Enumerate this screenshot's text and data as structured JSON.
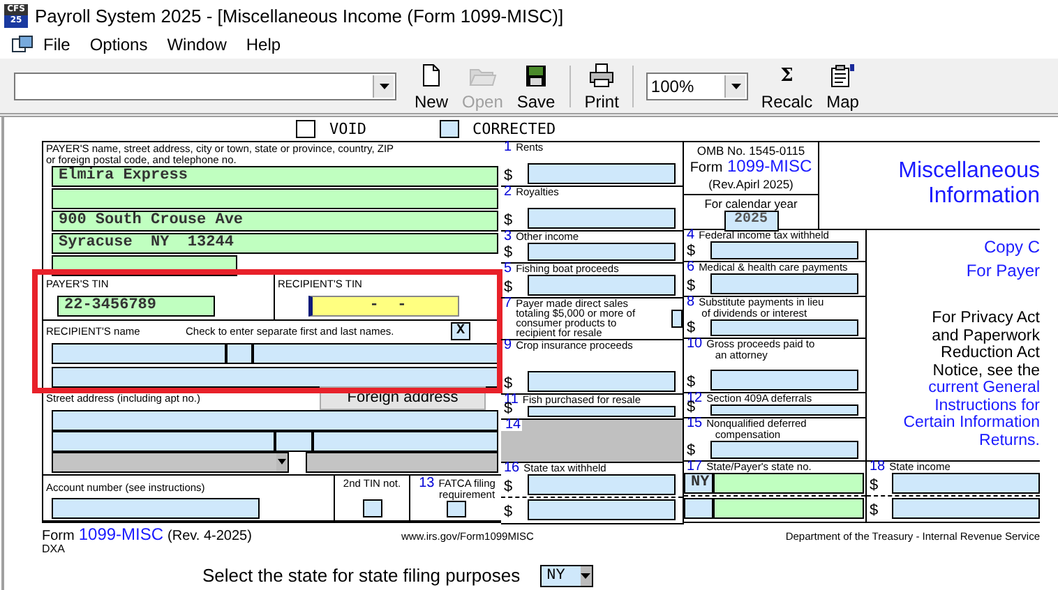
{
  "window": {
    "title": "Payroll System 2025 - [Miscellaneous Income (Form 1099-MISC)]",
    "logo": [
      "CFS",
      "25"
    ]
  },
  "menu": [
    "File",
    "Options",
    "Window",
    "Help"
  ],
  "toolbar": [
    {
      "kind": "combo"
    },
    {
      "kind": "button",
      "label": "New",
      "disabled": false
    },
    {
      "kind": "button",
      "label": "Open",
      "disabled": true
    },
    {
      "kind": "button",
      "label": "Save",
      "disabled": false
    },
    {
      "kind": "separator"
    },
    {
      "kind": "button",
      "label": "Print",
      "disabled": false
    },
    {
      "kind": "separator"
    },
    {
      "kind": "zoom",
      "value": "100%"
    },
    {
      "kind": "button",
      "label": "Recalc",
      "symbol": "Σ",
      "disabled": false
    },
    {
      "kind": "button",
      "label": "Map",
      "disabled": false
    }
  ],
  "form": {
    "marks": [
      {
        "label": "VOID",
        "checked": false,
        "kind": "plain"
      },
      {
        "label": "CORRECTED",
        "checked": false,
        "kind": "field"
      }
    ],
    "payer": {
      "label": "PAYER'S name, street address, city or town, state or province, country, ZIP\nor foreign postal code, and telephone no.",
      "lines": [
        {
          "kind": "line",
          "value": "Elmira Express"
        },
        {
          "kind": "line"
        },
        {
          "kind": "line",
          "value": "900 South Crouse Ave"
        },
        {
          "kind": "line",
          "value": "Syracuse  NY  13244"
        },
        {
          "kind": "short"
        }
      ]
    },
    "payer_tin": {
      "label": "PAYER'S TIN",
      "value": "22-3456789"
    },
    "recipient_tin": {
      "label": "RECIPIENT'S TIN",
      "value": "-  -",
      "focused": true
    },
    "recipient_name": {
      "label": "RECIPIENT'S name",
      "check_label": "Check to enter separate first and last names.",
      "checked": true,
      "mark": "X",
      "highlighted": true
    },
    "street": {
      "label": "Street address (including apt no.)",
      "button": "Foreign address"
    },
    "account": {
      "label": "Account number (see instructions)"
    },
    "second_tin": {
      "label": "2nd TIN not.",
      "checked": false
    },
    "fatca": {
      "number": "13",
      "label": "FATCA filing\nrequirement",
      "checked": false
    },
    "left_boxes": [
      {
        "number": "1",
        "label": "Rents",
        "kind": "amount",
        "currency": "$"
      },
      {
        "number": "2",
        "label": "Royalties",
        "kind": "amount",
        "currency": "$"
      },
      {
        "number": "3",
        "label": "Other income",
        "kind": "amount",
        "currency": "$"
      },
      {
        "number": "5",
        "label": "Fishing boat proceeds",
        "kind": "amount",
        "currency": "$"
      },
      {
        "number": "7",
        "label": "Payer made direct sales\ntotaling $5,000 or more of\nconsumer products to\nrecipient for resale",
        "kind": "check",
        "checked": false
      },
      {
        "number": "9",
        "label": "Crop insurance proceeds",
        "kind": "amount",
        "currency": "$"
      },
      {
        "number": "11",
        "label": "Fish purchased for resale",
        "kind": "amount",
        "currency": "$"
      },
      {
        "number": "14",
        "kind": "shaded"
      },
      {
        "number": "16",
        "label": "State tax withheld",
        "kind": "amount2",
        "currencies": [
          "$",
          "$"
        ]
      }
    ],
    "omb": {
      "omb_no": "OMB No. 1545-0115",
      "form_label": "Form",
      "form_name": "1099-MISC",
      "revision": "(Rev.Apirl 2025)",
      "calendar_label": "For calendar year",
      "year": "2025"
    },
    "title": "Miscellaneous Information",
    "right_boxes": [
      {
        "number": "4",
        "label": "Federal income tax withheld",
        "kind": "amount",
        "currency": "$"
      },
      {
        "number": "6",
        "label": "Medical & health care payments",
        "kind": "amount",
        "currency": "$"
      },
      {
        "number": "8",
        "label": "Substitute payments in lieu\n of dividends or interest",
        "kind": "amount",
        "currency": "$"
      },
      {
        "number": "10",
        "label": "Gross proceeds paid to\n   an attorney",
        "kind": "amount",
        "currency": "$"
      },
      {
        "number": "12",
        "label": "Section 409A deferrals",
        "kind": "amount",
        "currency": "$"
      },
      {
        "number": "15",
        "label": "Nonqualified deferred\n   compensation",
        "kind": "amount",
        "currency": "$"
      },
      {
        "number": "17",
        "label": "State/Payer's state no.",
        "kind": "state",
        "rows": [
          {
            "kind": "filled",
            "state": "NY"
          },
          {
            "kind": "blank"
          }
        ]
      }
    ],
    "copy": "Copy C",
    "copy_for": "For Payer",
    "notice": "For Privacy Act and Paperwork Reduction Act Notice, see the",
    "notice_link": "current General Instructions for Certain Information Returns.",
    "box18": {
      "number": "18",
      "label": "State income",
      "kind": "amount2",
      "currencies": [
        "$",
        "$"
      ]
    }
  },
  "footer": {
    "form_label": "Form",
    "form_name": "1099-MISC",
    "revision": "(Rev. 4-2025)",
    "url": "www.irs.gov/Form1099MISC",
    "department": "Department of the Treasury - Internal Revenue Service",
    "code": "DXA"
  },
  "state_select": {
    "label": "Select the state for state filing purposes",
    "value": "NY"
  }
}
